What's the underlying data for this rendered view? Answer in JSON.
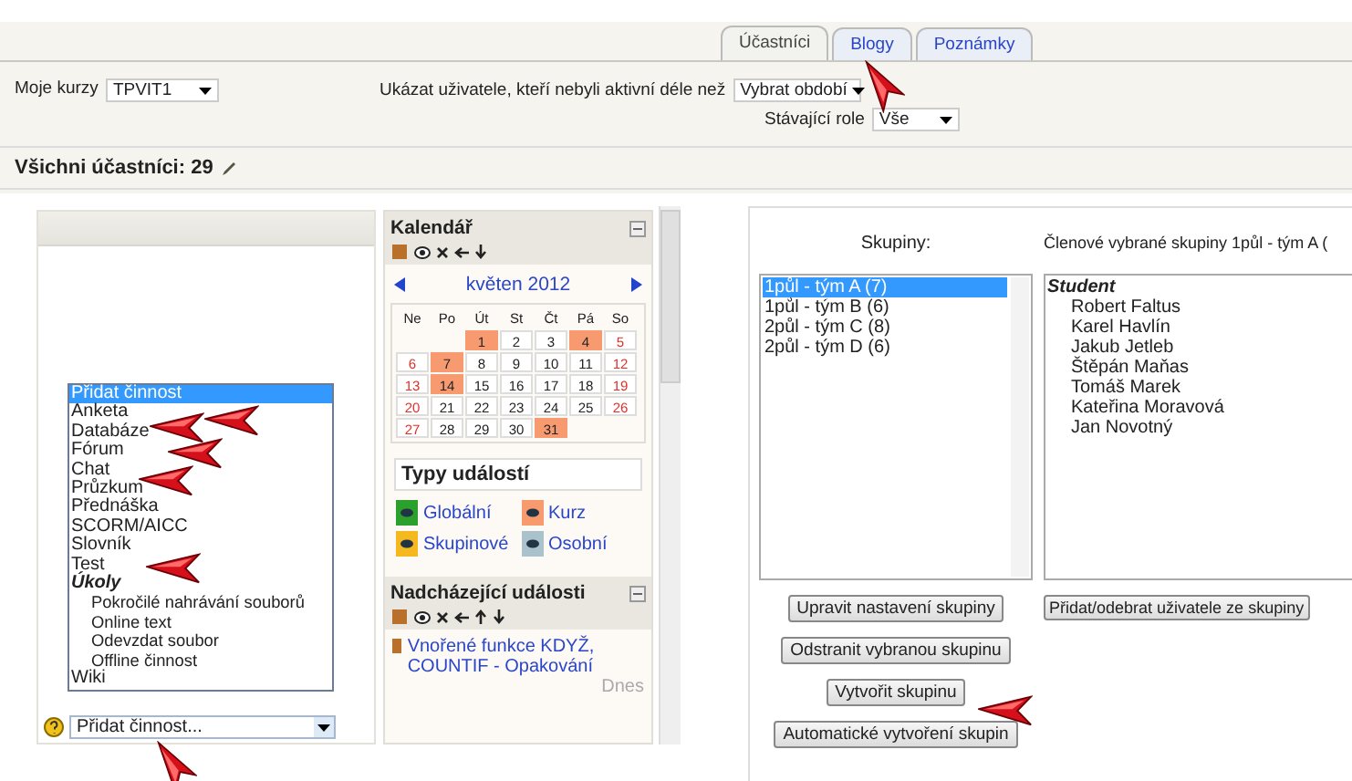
{
  "top": {
    "tabs": [
      {
        "label": "Účastníci",
        "selected": true
      },
      {
        "label": "Blogy",
        "selected": false
      },
      {
        "label": "Poznámky",
        "selected": false
      }
    ],
    "course_label": "Moje kurzy",
    "course_value": "TPVIT1",
    "inactive_label": "Ukázat uživatele, kteří nebyli aktivní déle než",
    "inactive_value": "Vybrat období",
    "role_label": "Stávající role",
    "role_value": "Vše",
    "participants": "Všichni účastníci: 29"
  },
  "activity": {
    "options": [
      {
        "label": "Přidat činnost",
        "kind": "option",
        "selected": true
      },
      {
        "label": "Anketa",
        "kind": "option",
        "selected": false
      },
      {
        "label": "Databáze",
        "kind": "option",
        "selected": false
      },
      {
        "label": "Fórum",
        "kind": "option",
        "selected": false
      },
      {
        "label": "Chat",
        "kind": "option",
        "selected": false
      },
      {
        "label": "Průzkum",
        "kind": "option",
        "selected": false
      },
      {
        "label": "Přednáška",
        "kind": "option",
        "selected": false
      },
      {
        "label": "SCORM/AICC",
        "kind": "option",
        "selected": false
      },
      {
        "label": "Slovník",
        "kind": "option",
        "selected": false
      },
      {
        "label": "Test",
        "kind": "option",
        "selected": false
      },
      {
        "label": "Úkoly",
        "kind": "group",
        "selected": false
      },
      {
        "label": "Pokročilé nahrávání souborů",
        "kind": "sub",
        "selected": false
      },
      {
        "label": "Online text",
        "kind": "sub",
        "selected": false
      },
      {
        "label": "Odevzdat soubor",
        "kind": "sub",
        "selected": false
      },
      {
        "label": "Offline činnost",
        "kind": "sub",
        "selected": false
      },
      {
        "label": "Wiki",
        "kind": "option",
        "selected": false
      }
    ],
    "select_value": "Přidat činnost..."
  },
  "calendar": {
    "title": "Kalendář",
    "month": "květen 2012",
    "weekdays": [
      "Ne",
      "Po",
      "Út",
      "St",
      "Čt",
      "Pá",
      "So"
    ],
    "weeks": [
      [
        {
          "day": "1",
          "event": true,
          "weekend": false
        },
        {
          "day": "2",
          "event": false,
          "weekend": false
        },
        {
          "day": "3",
          "event": false,
          "weekend": false
        },
        {
          "day": "4",
          "event": true,
          "weekend": false
        },
        {
          "day": "5",
          "event": false,
          "weekend": true
        }
      ],
      [
        {
          "day": "6",
          "event": false,
          "weekend": true
        },
        {
          "day": "7",
          "event": true,
          "weekend": false
        },
        {
          "day": "8",
          "event": false,
          "weekend": false
        },
        {
          "day": "9",
          "event": false,
          "weekend": false
        },
        {
          "day": "10",
          "event": false,
          "weekend": false
        },
        {
          "day": "11",
          "event": false,
          "weekend": false
        },
        {
          "day": "12",
          "event": false,
          "weekend": true
        }
      ],
      [
        {
          "day": "13",
          "event": false,
          "weekend": true
        },
        {
          "day": "14",
          "event": true,
          "weekend": false
        },
        {
          "day": "15",
          "event": false,
          "weekend": false
        },
        {
          "day": "16",
          "event": false,
          "weekend": false
        },
        {
          "day": "17",
          "event": false,
          "weekend": false
        },
        {
          "day": "18",
          "event": false,
          "weekend": false
        },
        {
          "day": "19",
          "event": false,
          "weekend": true
        }
      ],
      [
        {
          "day": "20",
          "event": false,
          "weekend": true
        },
        {
          "day": "21",
          "event": false,
          "weekend": false
        },
        {
          "day": "22",
          "event": false,
          "weekend": false
        },
        {
          "day": "23",
          "event": false,
          "weekend": false
        },
        {
          "day": "24",
          "event": false,
          "weekend": false
        },
        {
          "day": "25",
          "event": false,
          "weekend": false
        },
        {
          "day": "26",
          "event": false,
          "weekend": true
        }
      ],
      [
        {
          "day": "27",
          "event": false,
          "weekend": true
        },
        {
          "day": "28",
          "event": false,
          "weekend": false
        },
        {
          "day": "29",
          "event": false,
          "weekend": false
        },
        {
          "day": "30",
          "event": false,
          "weekend": false
        },
        {
          "day": "31",
          "event": true,
          "weekend": false
        }
      ]
    ],
    "event_types_title": "Typy událostí",
    "event_types": [
      {
        "label": "Globální",
        "color": "#2ca02c"
      },
      {
        "label": "Kurz",
        "color": "#f79a6e"
      },
      {
        "label": "Skupinové",
        "color": "#f5b81e"
      },
      {
        "label": "Osobní",
        "color": "#a9c2cb"
      }
    ],
    "upcoming_title": "Nadcházející události",
    "upcoming_event": "Vnořené funkce KDYŽ, COUNTIF - Opakování",
    "upcoming_when": "Dnes"
  },
  "groups": {
    "groups_label": "Skupiny:",
    "members_label": "Členové vybrané skupiny 1půl - tým A (",
    "items": [
      {
        "label": "1půl - tým A (7)",
        "selected": true
      },
      {
        "label": "1půl - tým B (6)",
        "selected": false
      },
      {
        "label": "2půl - tým C (8)",
        "selected": false
      },
      {
        "label": "2půl - tým D (6)",
        "selected": false
      }
    ],
    "member_role": "Student",
    "members": [
      "Robert Faltus",
      "Karel Havlín",
      "Jakub Jetleb",
      "Štěpán Maňas",
      "Tomáš Marek",
      "Kateřina Moravová",
      "Jan Novotný"
    ],
    "edit_button": "Upravit nastavení skupiny",
    "members_button": "Přidat/odebrat uživatele ze skupiny",
    "delete_button": "Odstranit vybranou skupinu",
    "create_button": "Vytvořit skupinu",
    "auto_button": "Automatické vytvoření skupin"
  }
}
